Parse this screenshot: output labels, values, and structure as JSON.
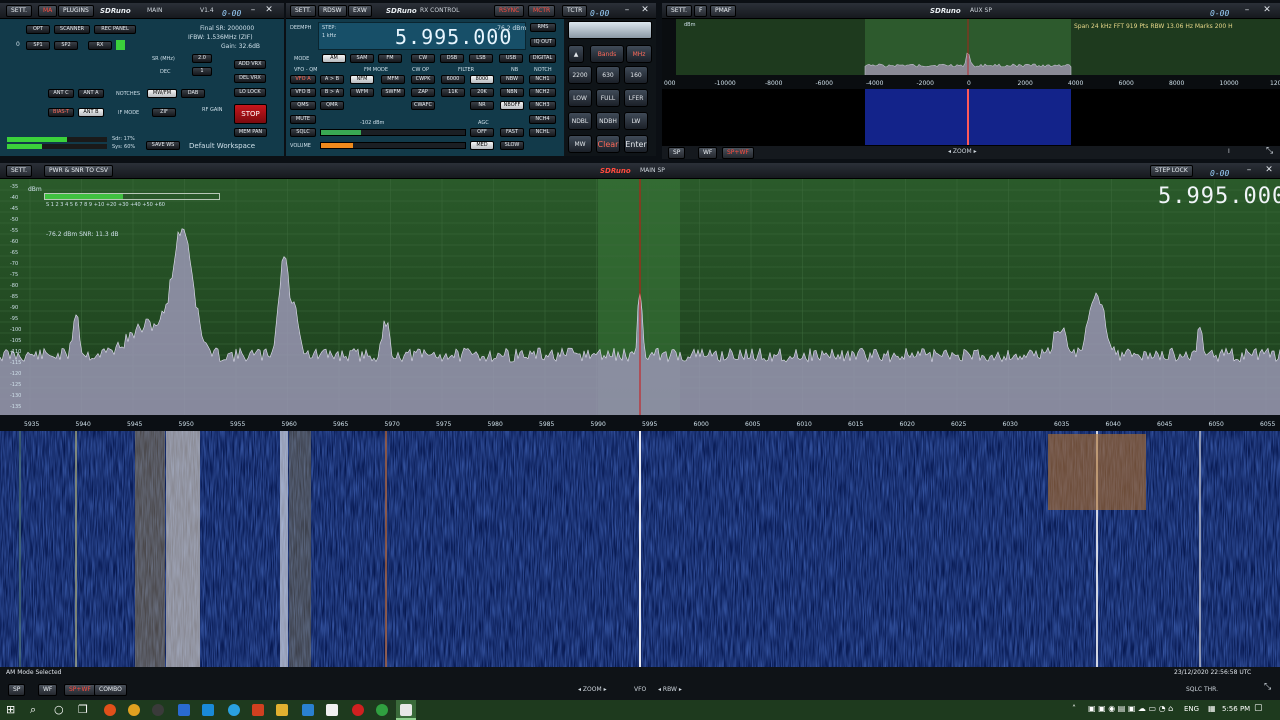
{
  "colors": {
    "accent_red": "#ff4a3d",
    "spectrum_green": "#2f6a2f",
    "waterfall_blue": "#0a1f5c",
    "vfo_line": "#d01010",
    "panel_teal": "#123a4a"
  },
  "main_window": {
    "buttons": {
      "sett": "SETT.",
      "ma": "MA",
      "plugins": "PLUGINS"
    },
    "title_app": "SDRuno",
    "title_panel": "MAIN",
    "version": "V1.4",
    "clock": "0-00"
  },
  "main_panel": {
    "opt": "OPT",
    "scanner": "SCANNER",
    "rec_panel": "REC PANEL",
    "sp1": "SP1",
    "sp2": "SP2",
    "rx": "RX",
    "zero": "0",
    "final_sr": "Final SR: 2000000",
    "ifbw": "IFBW: 1.536MHz (ZIF)",
    "gain": "Gain: 32.6dB",
    "sr_label": "SR (MHz)",
    "sr_value": "2.0",
    "dec_label": "DEC",
    "dec_value": "1",
    "add_vrx": "ADD VRX",
    "del_vrx": "DEL VRX",
    "lo_lock": "LO LOCK",
    "ant_c": "ANT C",
    "ant_a": "ANT A",
    "notches": "NOTCHES",
    "mw_fm": "MW/FM",
    "dab": "DAB",
    "bias_t": "BIAS-T",
    "ant_b": "ANT B",
    "if_mode": "IF MODE",
    "zif": "ZIF",
    "rf_gain": "RF GAIN",
    "stop": "STOP",
    "mem_pan": "MEM PAN",
    "sdr_cpu": "Sdr: 17%",
    "sys_cpu": "Sys: 60%",
    "save_ws": "SAVE WS",
    "workspace": "Default Workspace"
  },
  "rx_window": {
    "buttons": {
      "sett": "SETT.",
      "rdsw": "RDSW",
      "exw": "EXW",
      "rsync": "RSYNC",
      "mctr": "MCTR",
      "tctr": "TCTR"
    },
    "title_app": "SDRuno",
    "title_panel": "RX CONTROL",
    "clock": "0-00"
  },
  "rx_panel": {
    "deemph": "DEEMPH",
    "step_label": "STEP:",
    "step_value": "1 kHz",
    "frequency": "5.995.000",
    "level_dbm": "-76.2 dBm",
    "rms": "RMS",
    "iq_out": "IQ OUT",
    "mode_label": "MODE",
    "modes": [
      "AM",
      "SAM",
      "FM",
      "CW",
      "DSB",
      "LSB",
      "USB",
      "DIGITAL"
    ],
    "vfo_qm": "VFO - QM",
    "fm_mode": "FM MODE",
    "cw_op": "CW OP",
    "filter": "FILTER",
    "nb": "NB",
    "notch": "NOTCH",
    "vfo_a": "VFO A",
    "a_to_b": "A > B",
    "nfm": "NFM",
    "mfm": "MFM",
    "cwpk": "CWPK",
    "f6000": "6000",
    "f8000": "8000",
    "nbw": "NBW",
    "nch1": "NCH1",
    "vfo_b": "VFO B",
    "b_to_a": "B > A",
    "wfm": "WFM",
    "swfm": "SWFM",
    "zap": "ZAP",
    "f11k": "11K",
    "f20k": "20K",
    "nbn": "NBN",
    "nch2": "NCH2",
    "qms": "QMS",
    "qmr": "QMR",
    "cwafc": "CWAFC",
    "nr": "NR",
    "nboff": "NBOFF",
    "nch3": "NCH3",
    "mute": "MUTE",
    "squelch_level": "-102 dBm",
    "agc": "AGC",
    "nch4": "NCH4",
    "sqlc": "SQLC",
    "off": "OFF",
    "fast": "FAST",
    "nchl": "NCHL",
    "volume": "VOLUME",
    "med": "MED",
    "slow": "SLOW",
    "volume_level": 0.22,
    "squelch_fill": 0.28
  },
  "keypad": {
    "bands": "Bands",
    "mhz": "MHz",
    "keys": [
      "2200",
      "630",
      "160",
      "LOW",
      "FULL",
      "LFER",
      "NDBL",
      "NDBH",
      "LW",
      "MW"
    ],
    "clear": "Clear",
    "enter": "Enter"
  },
  "aux_window": {
    "buttons": {
      "sett": "SETT.",
      "f": "F",
      "pmaf": "PMAF"
    },
    "title_app": "SDRuno",
    "title_panel": "AUX SP",
    "clock": "0-00",
    "unit": "dBm",
    "info": "Span 24 kHz  FFT 919 Pts  RBW 13.06 Hz  Marks 200 H",
    "x_ticks": [
      "000",
      "-10000",
      "-8000",
      "-6000",
      "-4000",
      "-2000",
      "0",
      "2000",
      "4000",
      "6000",
      "8000",
      "10000",
      "120"
    ],
    "bottom": {
      "sp": "SP",
      "wf": "WF",
      "spwf": "SP+WF",
      "zoom": "ZOOM",
      "sq": "I"
    }
  },
  "sp_window": {
    "buttons": {
      "sett": "SETT.",
      "pwr_snr": "PWR & SNR TO CSV",
      "step_lock": "STEP LOCK"
    },
    "title_app": "SDRuno",
    "title_panel": "MAIN SP",
    "clock": "0-00",
    "big_frequency": "5.995.000",
    "dbm_label": "dBm",
    "s_meter": "S  1  2  3  4  5  6  7  8  9  +10  +20  +30  +40  +50  +60",
    "level_snr": "-76.2 dBm    SNR: 11.3 dB",
    "y_ticks": [
      "-35",
      "-40",
      "-45",
      "-50",
      "-55",
      "-60",
      "-65",
      "-70",
      "-75",
      "-80",
      "-85",
      "-90",
      "-95",
      "-100",
      "-105",
      "-110",
      "-115",
      "-120",
      "-125",
      "-130",
      "-135"
    ],
    "x_ticks": [
      "5935",
      "5940",
      "5945",
      "5950",
      "5955",
      "5960",
      "5965",
      "5970",
      "5975",
      "5980",
      "5985",
      "5990",
      "5995",
      "6000",
      "6005",
      "6010",
      "6015",
      "6020",
      "6025",
      "6030",
      "6035",
      "6040",
      "6045",
      "6050",
      "6055"
    ],
    "status": "AM Mode Selected",
    "timestamp": "23/12/2020 22:56:58 UTC",
    "bottom": {
      "sp": "SP",
      "wf": "WF",
      "spwf": "SP+WF",
      "combo": "COMBO",
      "zoom": "ZOOM",
      "vfo": "VFO",
      "rbw": "RBW",
      "sqlc_thr": "SQLC THR."
    }
  },
  "taskbar": {
    "lang": "ENG",
    "time": "5:56 PM"
  }
}
